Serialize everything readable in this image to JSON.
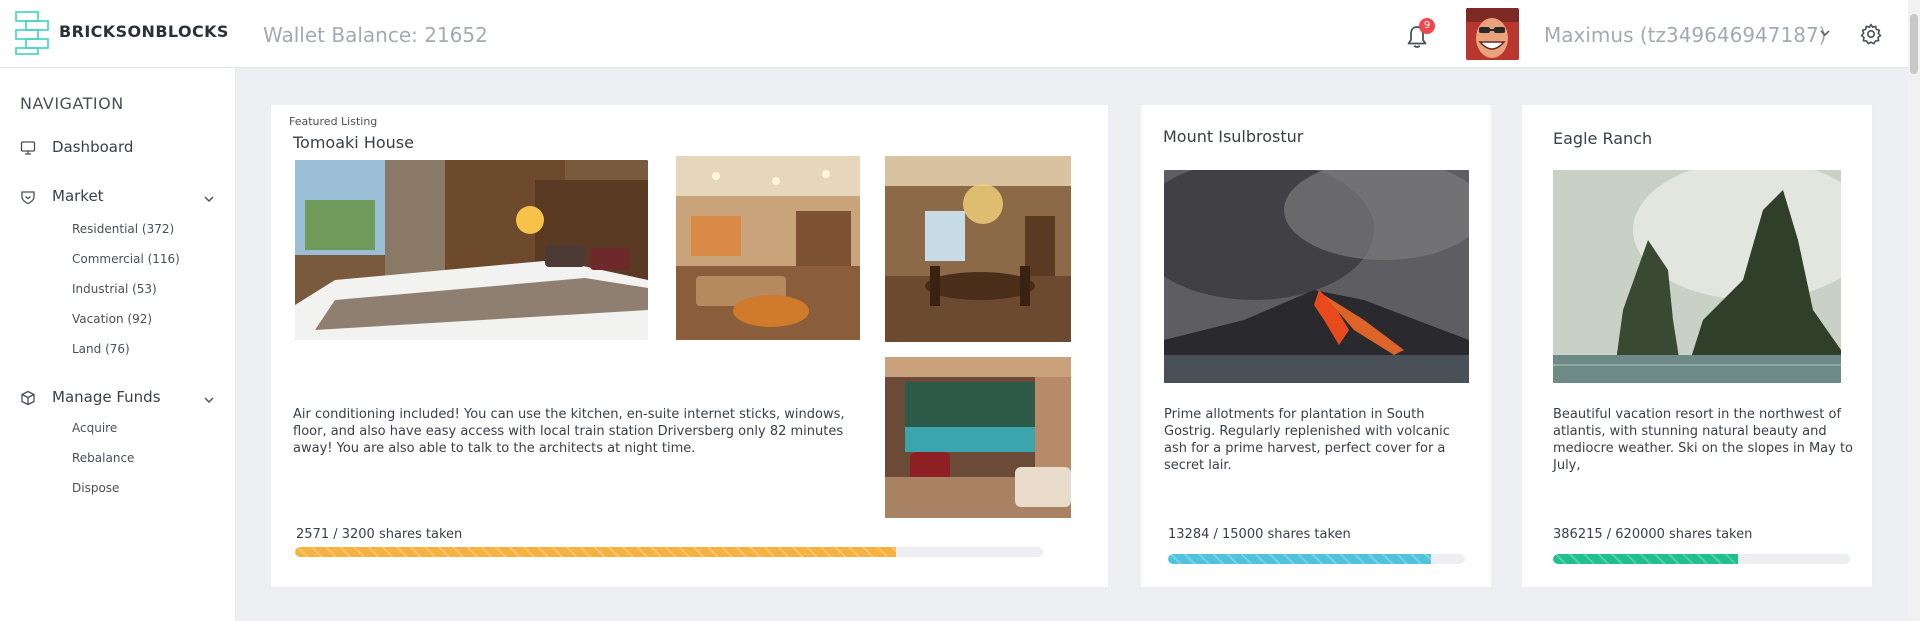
{
  "header": {
    "brand": "BRICKSONBLOCKS",
    "wallet_label": "Wallet Balance: 21652",
    "notifications_count": "9",
    "user": "Maximus (tz349646947187)"
  },
  "sidebar": {
    "title": "NAVIGATION",
    "dashboard": "Dashboard",
    "market": {
      "label": "Market",
      "items": [
        "Residential (372)",
        "Commercial (116)",
        "Industrial (53)",
        "Vacation (92)",
        "Land (76)"
      ]
    },
    "funds": {
      "label": "Manage Funds",
      "items": [
        "Acquire",
        "Rebalance",
        "Dispose"
      ]
    }
  },
  "listings": [
    {
      "kicker": "Featured Listing",
      "title": "Tomoaki House",
      "description": "Air conditioning included! You can use the kitchen, en-suite internet sticks, windows, floor, and also have easy access with local train station Driversberg only 82 minutes away! You are also able to talk to the architects at night time.",
      "shares_label": "2571 / 3200 shares taken",
      "progress": 0.8034,
      "color": "#f6b23e"
    },
    {
      "title": "Mount Isulbrostur",
      "description": "Prime allotments for plantation in South Gostrig. Regularly replenished with volcanic ash for a prime harvest, perfect cover for a secret lair.",
      "shares_label": "13284 / 15000 shares taken",
      "progress": 0.8856,
      "color": "#4fc3dc"
    },
    {
      "title": "Eagle Ranch",
      "description": "Beautiful vacation resort in the northwest of atlantis, with stunning natural beauty and mediocre weather. Ski on the slopes in May to July,",
      "shares_label": "386215 / 620000 shares taken",
      "progress": 0.6229,
      "color": "#1fbf8f"
    }
  ],
  "colors": {
    "accent_logo": "#3ed3c0",
    "badge": "#f0464f"
  }
}
